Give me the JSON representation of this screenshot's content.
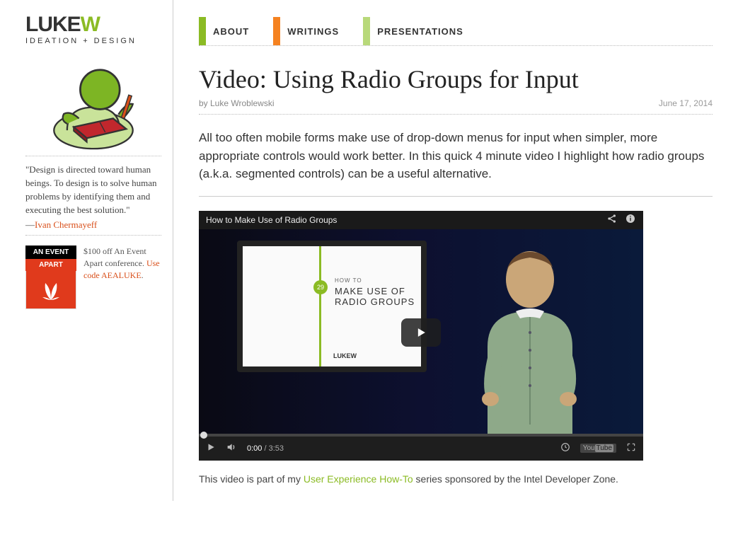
{
  "logo": {
    "brand_pre": "LUKE",
    "brand_w": "W",
    "sub": "IDEATION + DESIGN"
  },
  "quote": {
    "text": "\"Design is directed toward human beings. To design is to solve human problems by identifying them and executing the best solution.\"",
    "dash": "—",
    "author": "Ivan Chermayeff"
  },
  "promo": {
    "badge1": "AN EVENT",
    "badge2": "APART",
    "text1": "$100 off An Event Apart conference. ",
    "link": "Use code AEALUKE",
    "period": "."
  },
  "nav": {
    "about": "ABOUT",
    "writings": "WRITINGS",
    "presentations": "PRESENTATIONS"
  },
  "article": {
    "title": "Video: Using Radio Groups for Input",
    "byline": "by Luke Wroblewski",
    "date": "June 17, 2014",
    "intro": "All too often mobile forms make use of drop-down menus for input when simpler, more appropriate controls would work better. In this quick 4 minute video I highlight how radio groups (a.k.a. segmented controls) can be a useful alternative."
  },
  "video": {
    "top_title": "How to Make Use of Radio Groups",
    "slide_howto": "HOW TO",
    "slide_big": "MAKE USE OF RADIO GROUPS",
    "slide_dot": "29",
    "slide_logo": "LUKEW",
    "time_current": "0:00",
    "time_total": "3:53",
    "youtube": "YouTube"
  },
  "caption": {
    "pre": "This video is part of my ",
    "link": "User Experience How-To",
    "post": " series sponsored by the Intel Developer Zone."
  }
}
